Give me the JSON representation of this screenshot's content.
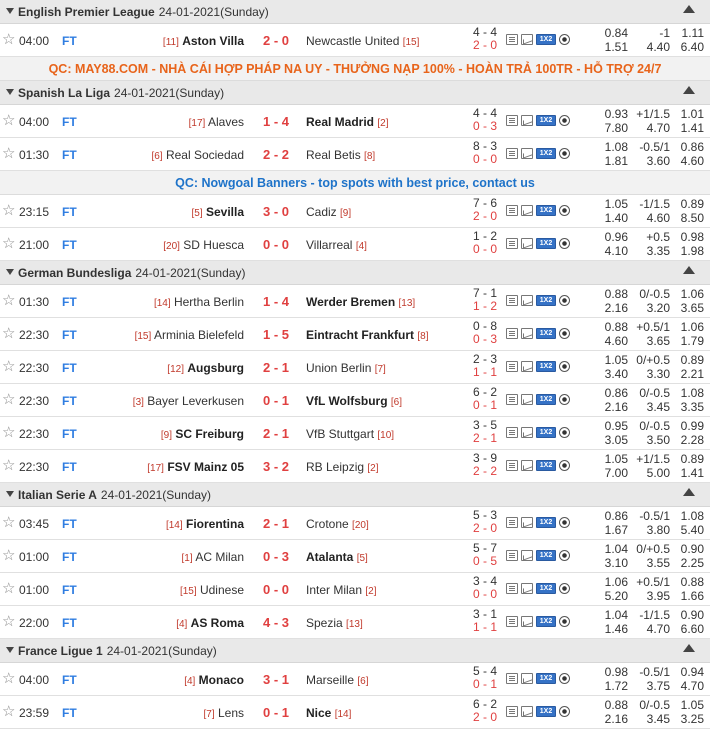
{
  "sections": [
    {
      "type": "league",
      "name": "English Premier League",
      "date": "24-01-2021(Sunday)",
      "matches": [
        {
          "time": "04:00",
          "status": "FT",
          "home_rank": "[11]",
          "home": "Aston Villa",
          "score": "2 - 0",
          "away": "Newcastle United",
          "away_rank": "[15]",
          "winner": "home",
          "corner_top": "4 - 4",
          "corner_bottom": "2 - 0",
          "odds_top": [
            "0.84",
            "-1",
            "1.11"
          ],
          "odds_bottom": [
            "1.51",
            "4.40",
            "6.40"
          ]
        }
      ]
    },
    {
      "type": "ad",
      "style": "orange",
      "text": "QC: MAY88.COM - NHÀ CÁI HỢP PHÁP NA UY - THƯỞNG NẠP 100% - HOÀN TRẢ 100TR - HỖ TRỢ 24/7"
    },
    {
      "type": "league",
      "name": "Spanish La Liga",
      "date": "24-01-2021(Sunday)",
      "matches": [
        {
          "time": "04:00",
          "status": "FT",
          "home_rank": "[17]",
          "home": "Alaves",
          "score": "1 - 4",
          "away": "Real Madrid",
          "away_rank": "[2]",
          "winner": "away",
          "corner_top": "4 - 4",
          "corner_bottom": "0 - 3",
          "odds_top": [
            "0.93",
            "+1/1.5",
            "1.01"
          ],
          "odds_bottom": [
            "7.80",
            "4.70",
            "1.41"
          ]
        },
        {
          "time": "01:30",
          "status": "FT",
          "home_rank": "[6]",
          "home": "Real Sociedad",
          "score": "2 - 2",
          "away": "Real Betis",
          "away_rank": "[8]",
          "winner": "none",
          "corner_top": "8 - 3",
          "corner_bottom": "0 - 0",
          "odds_top": [
            "1.08",
            "-0.5/1",
            "0.86"
          ],
          "odds_bottom": [
            "1.81",
            "3.60",
            "4.60"
          ]
        }
      ]
    },
    {
      "type": "ad",
      "style": "blue",
      "text": "QC: Nowgoal Banners - top spots with best price, contact us"
    },
    {
      "type": "matches",
      "matches": [
        {
          "time": "23:15",
          "status": "FT",
          "home_rank": "[5]",
          "home": "Sevilla",
          "score": "3 - 0",
          "away": "Cadiz",
          "away_rank": "[9]",
          "winner": "home",
          "corner_top": "7 - 6",
          "corner_bottom": "2 - 0",
          "odds_top": [
            "1.05",
            "-1/1.5",
            "0.89"
          ],
          "odds_bottom": [
            "1.40",
            "4.60",
            "8.50"
          ]
        },
        {
          "time": "21:00",
          "status": "FT",
          "home_rank": "[20]",
          "home": "SD Huesca",
          "score": "0 - 0",
          "away": "Villarreal",
          "away_rank": "[4]",
          "winner": "none",
          "corner_top": "1 - 2",
          "corner_bottom": "0 - 0",
          "odds_top": [
            "0.96",
            "+0.5",
            "0.98"
          ],
          "odds_bottom": [
            "4.10",
            "3.35",
            "1.98"
          ]
        }
      ]
    },
    {
      "type": "league",
      "name": "German Bundesliga",
      "date": "24-01-2021(Sunday)",
      "matches": [
        {
          "time": "01:30",
          "status": "FT",
          "home_rank": "[14]",
          "home": "Hertha Berlin",
          "score": "1 - 4",
          "away": "Werder Bremen",
          "away_rank": "[13]",
          "winner": "away",
          "corner_top": "7 - 1",
          "corner_bottom": "1 - 2",
          "odds_top": [
            "0.88",
            "0/-0.5",
            "1.06"
          ],
          "odds_bottom": [
            "2.16",
            "3.20",
            "3.65"
          ]
        },
        {
          "time": "22:30",
          "status": "FT",
          "home_rank": "[15]",
          "home": "Arminia Bielefeld",
          "score": "1 - 5",
          "away": "Eintracht Frankfurt",
          "away_rank": "[8]",
          "winner": "away",
          "corner_top": "0 - 8",
          "corner_bottom": "0 - 3",
          "odds_top": [
            "0.88",
            "+0.5/1",
            "1.06"
          ],
          "odds_bottom": [
            "4.60",
            "3.65",
            "1.79"
          ]
        },
        {
          "time": "22:30",
          "status": "FT",
          "home_rank": "[12]",
          "home": "Augsburg",
          "score": "2 - 1",
          "away": "Union Berlin",
          "away_rank": "[7]",
          "winner": "home",
          "corner_top": "2 - 3",
          "corner_bottom": "1 - 1",
          "odds_top": [
            "1.05",
            "0/+0.5",
            "0.89"
          ],
          "odds_bottom": [
            "3.40",
            "3.30",
            "2.21"
          ]
        },
        {
          "time": "22:30",
          "status": "FT",
          "home_rank": "[3]",
          "home": "Bayer Leverkusen",
          "score": "0 - 1",
          "away": "VfL Wolfsburg",
          "away_rank": "[6]",
          "winner": "away",
          "corner_top": "6 - 2",
          "corner_bottom": "0 - 1",
          "odds_top": [
            "0.86",
            "0/-0.5",
            "1.08"
          ],
          "odds_bottom": [
            "2.16",
            "3.45",
            "3.35"
          ]
        },
        {
          "time": "22:30",
          "status": "FT",
          "home_rank": "[9]",
          "home": "SC Freiburg",
          "score": "2 - 1",
          "away": "VfB Stuttgart",
          "away_rank": "[10]",
          "winner": "home",
          "corner_top": "3 - 5",
          "corner_bottom": "2 - 1",
          "odds_top": [
            "0.95",
            "0/-0.5",
            "0.99"
          ],
          "odds_bottom": [
            "3.05",
            "3.50",
            "2.28"
          ]
        },
        {
          "time": "22:30",
          "status": "FT",
          "home_rank": "[17]",
          "home": "FSV Mainz 05",
          "score": "3 - 2",
          "away": "RB Leipzig",
          "away_rank": "[2]",
          "winner": "home",
          "corner_top": "3 - 9",
          "corner_bottom": "2 - 2",
          "odds_top": [
            "1.05",
            "+1/1.5",
            "0.89"
          ],
          "odds_bottom": [
            "7.00",
            "5.00",
            "1.41"
          ]
        }
      ]
    },
    {
      "type": "league",
      "name": "Italian Serie A",
      "date": "24-01-2021(Sunday)",
      "matches": [
        {
          "time": "03:45",
          "status": "FT",
          "home_rank": "[14]",
          "home": "Fiorentina",
          "score": "2 - 1",
          "away": "Crotone",
          "away_rank": "[20]",
          "winner": "home",
          "corner_top": "5 - 3",
          "corner_bottom": "2 - 0",
          "odds_top": [
            "0.86",
            "-0.5/1",
            "1.08"
          ],
          "odds_bottom": [
            "1.67",
            "3.80",
            "5.40"
          ]
        },
        {
          "time": "01:00",
          "status": "FT",
          "home_rank": "[1]",
          "home": "AC Milan",
          "score": "0 - 3",
          "away": "Atalanta",
          "away_rank": "[5]",
          "winner": "away",
          "corner_top": "5 - 7",
          "corner_bottom": "0 - 5",
          "odds_top": [
            "1.04",
            "0/+0.5",
            "0.90"
          ],
          "odds_bottom": [
            "3.10",
            "3.55",
            "2.25"
          ]
        },
        {
          "time": "01:00",
          "status": "FT",
          "home_rank": "[15]",
          "home": "Udinese",
          "score": "0 - 0",
          "away": "Inter Milan",
          "away_rank": "[2]",
          "winner": "none",
          "corner_top": "3 - 4",
          "corner_bottom": "0 - 0",
          "odds_top": [
            "1.06",
            "+0.5/1",
            "0.88"
          ],
          "odds_bottom": [
            "5.20",
            "3.95",
            "1.66"
          ]
        },
        {
          "time": "22:00",
          "status": "FT",
          "home_rank": "[4]",
          "home": "AS Roma",
          "score": "4 - 3",
          "away": "Spezia",
          "away_rank": "[13]",
          "winner": "home",
          "corner_top": "3 - 1",
          "corner_bottom": "1 - 1",
          "odds_top": [
            "1.04",
            "-1/1.5",
            "0.90"
          ],
          "odds_bottom": [
            "1.46",
            "4.70",
            "6.60"
          ]
        }
      ]
    },
    {
      "type": "league",
      "name": "France Ligue 1",
      "date": "24-01-2021(Sunday)",
      "matches": [
        {
          "time": "04:00",
          "status": "FT",
          "home_rank": "[4]",
          "home": "Monaco",
          "score": "3 - 1",
          "away": "Marseille",
          "away_rank": "[6]",
          "winner": "home",
          "corner_top": "5 - 4",
          "corner_bottom": "0 - 1",
          "odds_top": [
            "0.98",
            "-0.5/1",
            "0.94"
          ],
          "odds_bottom": [
            "1.72",
            "3.75",
            "4.70"
          ]
        },
        {
          "time": "23:59",
          "status": "FT",
          "home_rank": "[7]",
          "home": "Lens",
          "score": "0 - 1",
          "away": "Nice",
          "away_rank": "[14]",
          "winner": "away",
          "corner_top": "6 - 2",
          "corner_bottom": "2 - 0",
          "odds_top": [
            "0.88",
            "0/-0.5",
            "1.05"
          ],
          "odds_bottom": [
            "2.16",
            "3.45",
            "3.25"
          ]
        }
      ]
    }
  ],
  "icons": {
    "star": "☆",
    "action_icons": [
      "document-icon",
      "chart-icon",
      "vs-icon",
      "ball-icon"
    ]
  },
  "colors": {
    "status": "#2f7de1",
    "score": "#e04040",
    "rank": "#c0392b",
    "ad_orange": "#e8641b",
    "ad_blue": "#1e73c9",
    "league_bg": "#e9e9e9"
  }
}
